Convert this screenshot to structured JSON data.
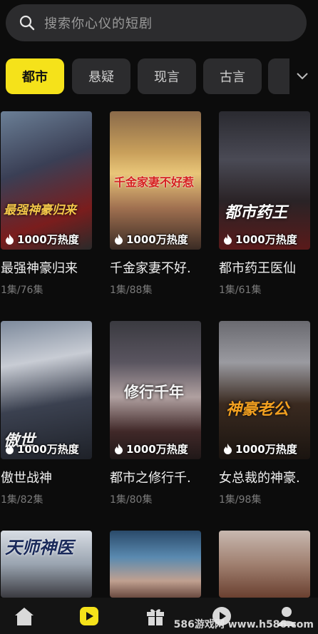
{
  "search": {
    "placeholder": "搜索你心仪的短剧",
    "icon": "search-icon"
  },
  "tabs": [
    {
      "label": "都市",
      "active": true
    },
    {
      "label": "悬疑",
      "active": false
    },
    {
      "label": "现言",
      "active": false
    },
    {
      "label": "古言",
      "active": false
    }
  ],
  "dramas": [
    {
      "title": "最强神豪归来",
      "episodes": "1集/76集",
      "heat": "1000万热度",
      "art": "最强神豪归来"
    },
    {
      "title": "千金家妻不好.",
      "episodes": "1集/88集",
      "heat": "1000万热度",
      "art": "千金家妻不好惹"
    },
    {
      "title": "都市药王医仙",
      "episodes": "1集/61集",
      "heat": "1000万热度",
      "art": "都市药王"
    },
    {
      "title": "傲世战神",
      "episodes": "1集/82集",
      "heat": "1000万热度",
      "art": "傲世"
    },
    {
      "title": "都市之修行千.",
      "episodes": "1集/80集",
      "heat": "1000万热度",
      "art": "修行千年"
    },
    {
      "title": "女总裁的神豪.",
      "episodes": "1集/98集",
      "heat": "1000万热度",
      "art": "神豪老公"
    },
    {
      "title": "",
      "episodes": "",
      "heat": "",
      "art": "天师神医"
    },
    {
      "title": "",
      "episodes": "",
      "heat": "",
      "art": ""
    },
    {
      "title": "",
      "episodes": "",
      "heat": "",
      "art": ""
    }
  ],
  "tabbar": {
    "items": [
      "home-icon",
      "play-icon",
      "gift-icon",
      "video-icon",
      "profile-icon"
    ],
    "active_color": "#f5e21a"
  },
  "watermark": "586游戏网 www.h586.com",
  "colors": {
    "accent": "#f5e21a",
    "background": "#0c0c0c",
    "chip": "#2c2c2e"
  }
}
